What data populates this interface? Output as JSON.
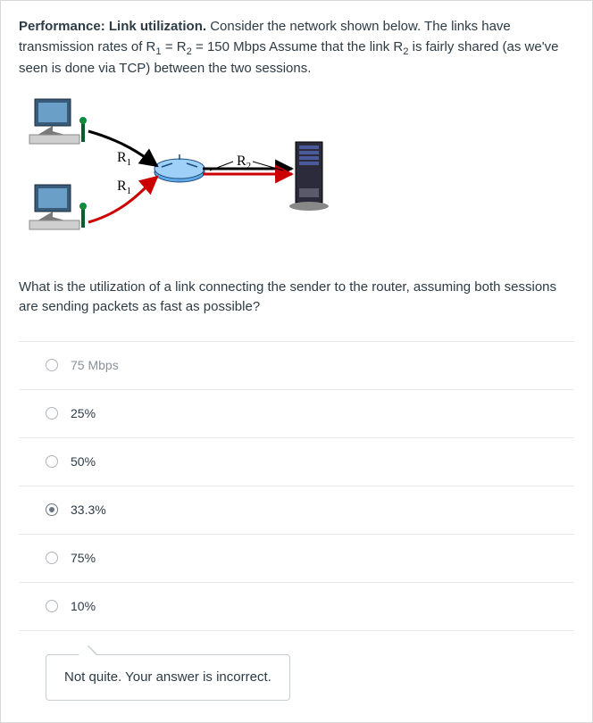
{
  "question": {
    "title": "Performance: Link utilization.",
    "body_before": " Consider the network shown below. The links have transmission rates of R",
    "r1_sub": "1",
    "eq": " = R",
    "r2_sub": "2",
    "body_after": " = 150 Mbps Assume that the link R",
    "r2b_sub": "2",
    "tail": " is fairly shared (as we've seen is done via TCP) between the two sessions."
  },
  "diagram": {
    "label_r1_top": "R₁",
    "label_r1_bot": "R₁",
    "label_r2": "R₂"
  },
  "prompt": "What is the utilization of a link connecting the sender to the router, assuming both sessions are sending packets as fast as possible?",
  "answers": [
    {
      "label": "75 Mbps",
      "selected": false,
      "dim": true
    },
    {
      "label": "25%",
      "selected": false,
      "dim": false
    },
    {
      "label": "50%",
      "selected": false,
      "dim": false
    },
    {
      "label": "33.3%",
      "selected": true,
      "dim": false
    },
    {
      "label": "75%",
      "selected": false,
      "dim": false
    },
    {
      "label": "10%",
      "selected": false,
      "dim": false
    }
  ],
  "feedback": "Not quite. Your answer is incorrect."
}
